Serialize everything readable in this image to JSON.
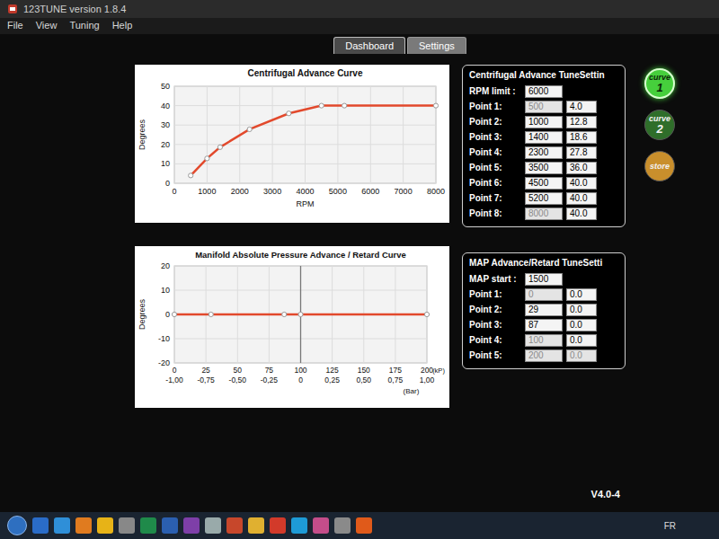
{
  "window": {
    "title": "123TUNE  version 1.8.4"
  },
  "menu": [
    "File",
    "View",
    "Tuning",
    "Help"
  ],
  "tabs": [
    {
      "label": "Dashboard",
      "selected": true
    },
    {
      "label": "Settings",
      "selected": false
    }
  ],
  "centrifugal_chart": {
    "title": "Centrifugal Advance Curve",
    "y_label": "Degrees",
    "x_label": "RPM",
    "y_ticks": [
      "0",
      "10",
      "20",
      "30",
      "40",
      "50"
    ],
    "x_ticks": [
      "0",
      "1000",
      "2000",
      "3000",
      "4000",
      "5000",
      "6000",
      "7000",
      "8000"
    ],
    "series": {
      "rpm": [
        500,
        1000,
        1400,
        2300,
        3500,
        4500,
        5200,
        8000
      ],
      "degrees": [
        4.0,
        12.8,
        18.6,
        27.8,
        36.0,
        40.0,
        40.0,
        40.0
      ]
    }
  },
  "map_chart": {
    "title": "Manifold Absolute Pressure Advance / Retard Curve",
    "y_label": "Degrees",
    "y_ticks": [
      "-20",
      "-10",
      "0",
      "10",
      "20"
    ],
    "x_ticks_kpa": [
      "0",
      "25",
      "50",
      "75",
      "100",
      "125",
      "150",
      "175",
      "200"
    ],
    "kpa_unit": "(kP)",
    "x_ticks_bar": [
      "-1,00",
      "-0,75",
      "-0,50",
      "-0,25",
      "0",
      "0,25",
      "0,50",
      "0,75",
      "1,00"
    ],
    "bar_unit": "(Bar)",
    "series": {
      "kpa": [
        0,
        29,
        87,
        100,
        200
      ],
      "degrees": [
        0,
        0,
        0,
        0,
        0
      ]
    }
  },
  "centrifugal_settings": {
    "title": "Centrifugal Advance TuneSettin",
    "rpm_limit_label": "RPM limit :",
    "rpm_limit": "6000",
    "points": [
      {
        "label": "Point 1:",
        "rpm": "500",
        "deg": "4.0",
        "rpm_disabled": true
      },
      {
        "label": "Point 2:",
        "rpm": "1000",
        "deg": "12.8",
        "rpm_disabled": false
      },
      {
        "label": "Point 3:",
        "rpm": "1400",
        "deg": "18.6",
        "rpm_disabled": false
      },
      {
        "label": "Point 4:",
        "rpm": "2300",
        "deg": "27.8",
        "rpm_disabled": false
      },
      {
        "label": "Point 5:",
        "rpm": "3500",
        "deg": "36.0",
        "rpm_disabled": false
      },
      {
        "label": "Point 6:",
        "rpm": "4500",
        "deg": "40.0",
        "rpm_disabled": false
      },
      {
        "label": "Point 7:",
        "rpm": "5200",
        "deg": "40.0",
        "rpm_disabled": false
      },
      {
        "label": "Point 8:",
        "rpm": "8000",
        "deg": "40.0",
        "rpm_disabled": true
      }
    ]
  },
  "map_settings": {
    "title": "MAP Advance/Retard TuneSetti",
    "start_label": "MAP start :",
    "start": "1500",
    "points": [
      {
        "label": "Point 1:",
        "kpa": "0",
        "deg": "0.0",
        "kpa_disabled": true,
        "deg_disabled": false
      },
      {
        "label": "Point 2:",
        "kpa": "29",
        "deg": "0.0",
        "kpa_disabled": false,
        "deg_disabled": false
      },
      {
        "label": "Point 3:",
        "kpa": "87",
        "deg": "0.0",
        "kpa_disabled": false,
        "deg_disabled": false
      },
      {
        "label": "Point 4:",
        "kpa": "100",
        "deg": "0.0",
        "kpa_disabled": true,
        "deg_disabled": false
      },
      {
        "label": "Point 5:",
        "kpa": "200",
        "deg": "0.0",
        "kpa_disabled": true,
        "deg_disabled": true
      }
    ]
  },
  "buttons": [
    {
      "label": "curve",
      "number": "1",
      "selected": true,
      "color": "#46cf3c"
    },
    {
      "label": "curve",
      "number": "2",
      "selected": false,
      "color": "#2f6e2a"
    },
    {
      "label": "store",
      "number": "",
      "selected": false,
      "color": "#c98f2c"
    }
  ],
  "version": "V4.0-4",
  "taskbar": {
    "tray": "FR"
  }
}
